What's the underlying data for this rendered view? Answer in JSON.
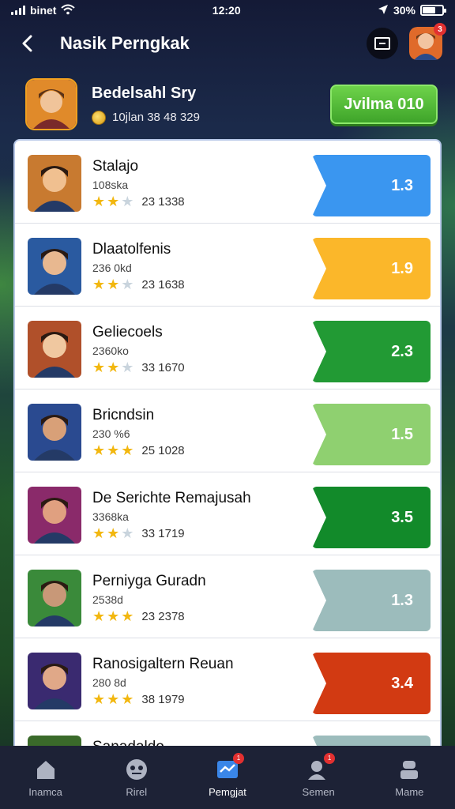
{
  "status_bar": {
    "carrier": "binet",
    "time": "12:20",
    "battery": "30%"
  },
  "header": {
    "title": "Nasik Perngkak"
  },
  "profile": {
    "name": "Bedelsahl Sry",
    "sub": "10jlan 38 48 329",
    "join_label": "Jvilma 010"
  },
  "rows": [
    {
      "title": "Stalajo",
      "sub": "108ska",
      "stars": 2,
      "count": "23 1338",
      "value": "1.3",
      "color": "#3a96f0",
      "avatar_bg": "#c87a30",
      "face": "#f0c090"
    },
    {
      "title": "Dlaatolfenis",
      "sub": "236 0kd",
      "stars": 2,
      "count": "23 1638",
      "value": "1.9",
      "color": "#fbb72a",
      "avatar_bg": "#2a5aa0",
      "face": "#e8b890"
    },
    {
      "title": "Geliecoels",
      "sub": "2360ko",
      "stars": 2,
      "count": "33 1670",
      "value": "2.3",
      "color": "#229a34",
      "avatar_bg": "#b0502a",
      "face": "#f0c8a0"
    },
    {
      "title": "Bricndsin",
      "sub": "230 %6",
      "stars": 3,
      "count": "25 1028",
      "value": "1.5",
      "color": "#8fd070",
      "avatar_bg": "#2a4a90",
      "face": "#d8a078"
    },
    {
      "title": "De Serichte Remajusah",
      "sub": "3368ka",
      "stars": 2,
      "count": "33 1719",
      "value": "3.5",
      "color": "#128a2a",
      "avatar_bg": "#8a2a6a",
      "face": "#e0a080"
    },
    {
      "title": "Perniyga Guradn",
      "sub": "2538d",
      "stars": 3,
      "count": "23 2378",
      "value": "1.3",
      "color": "#9cbcbc",
      "avatar_bg": "#3a8a3a",
      "face": "#c89878"
    },
    {
      "title": "Ranosigaltern Reuan",
      "sub": "280 8d",
      "stars": 3,
      "count": "38 1979",
      "value": "3.4",
      "color": "#d23a12",
      "avatar_bg": "#3a2a70",
      "face": "#e0a888"
    },
    {
      "title": "Sanadaldo",
      "sub": "",
      "stars": 0,
      "count": "",
      "value": "",
      "color": "#9cbcbc",
      "avatar_bg": "#3a6a2a",
      "face": "#c89878"
    }
  ],
  "nav": [
    {
      "label": "Inamca",
      "icon": "home-icon"
    },
    {
      "label": "Rirel",
      "icon": "game-icon"
    },
    {
      "label": "Pemgjat",
      "icon": "ranking-icon",
      "badge": "1"
    },
    {
      "label": "Semen",
      "icon": "social-icon",
      "badge": "1"
    },
    {
      "label": "Mame",
      "icon": "profile-icon"
    }
  ]
}
